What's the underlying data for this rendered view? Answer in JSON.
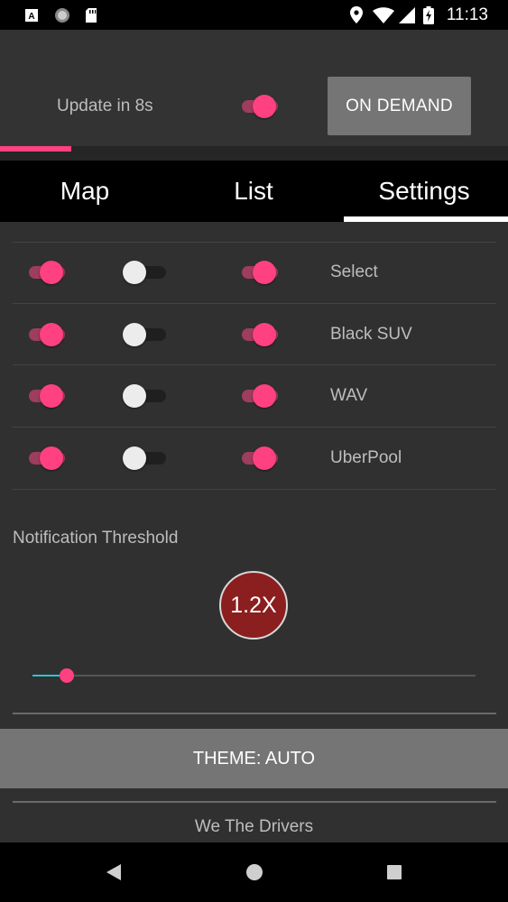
{
  "status_bar": {
    "time": "11:13",
    "icons": [
      "autofill-icon",
      "circle-app-icon",
      "sd-card-icon",
      "location-icon",
      "wifi-icon",
      "signal-icon",
      "battery-charging-icon"
    ]
  },
  "header": {
    "update_text": "Update in 8s",
    "auto_update_on": true,
    "on_demand_label": "ON DEMAND",
    "progress_percent": 14
  },
  "tabs": [
    {
      "label": "Map",
      "selected": false
    },
    {
      "label": "List",
      "selected": false
    },
    {
      "label": "Settings",
      "selected": true
    }
  ],
  "vehicle_rows": [
    {
      "label": "Select",
      "toggles": [
        true,
        false,
        true
      ]
    },
    {
      "label": "Black SUV",
      "toggles": [
        true,
        false,
        true
      ]
    },
    {
      "label": "WAV",
      "toggles": [
        true,
        false,
        true
      ]
    },
    {
      "label": "UberPool",
      "toggles": [
        true,
        false,
        true
      ]
    }
  ],
  "notification": {
    "label": "Notification Threshold",
    "value_badge": "1.2X",
    "slider_fraction": 0.077
  },
  "theme_button": "THEME: AUTO",
  "footer": "We The Drivers",
  "nav_bar": [
    "back-icon",
    "home-icon",
    "recents-icon"
  ],
  "colors": {
    "accent": "#ff4081",
    "badge": "#8b1e1e",
    "slider_active": "#26c6da",
    "background": "#303030"
  }
}
